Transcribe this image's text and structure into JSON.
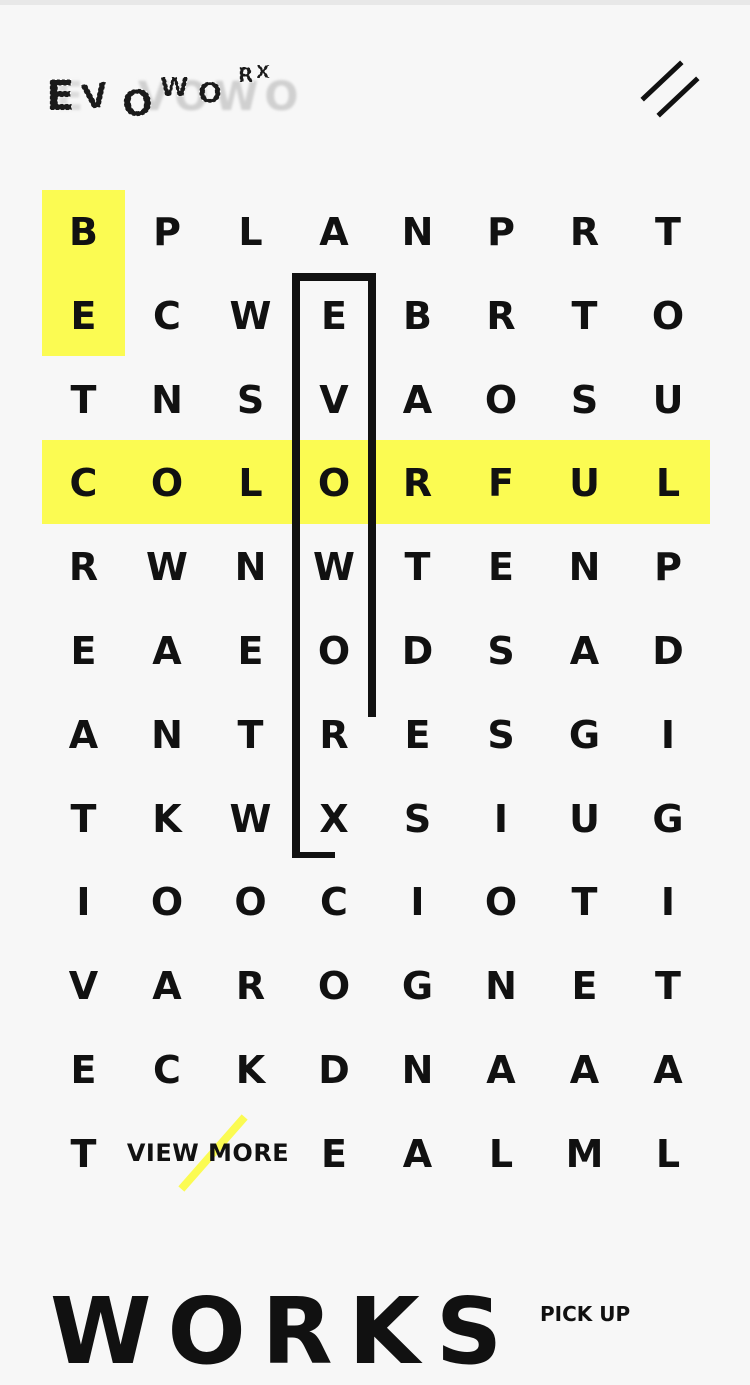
{
  "header": {
    "logo_text": "EVOWORX",
    "menu_icon": "double-slash-menu-icon"
  },
  "colors": {
    "background": "#f7f7f7",
    "highlight": "#fbfb52",
    "text": "#111111"
  },
  "puzzle": {
    "rows": [
      [
        "B",
        "P",
        "L",
        "A",
        "N",
        "P",
        "R",
        "T"
      ],
      [
        "E",
        "C",
        "W",
        "E",
        "B",
        "R",
        "T",
        "O"
      ],
      [
        "T",
        "N",
        "S",
        "V",
        "A",
        "O",
        "S",
        "U"
      ],
      [
        "C",
        "O",
        "L",
        "O",
        "R",
        "F",
        "U",
        "L"
      ],
      [
        "R",
        "W",
        "N",
        "W",
        "T",
        "E",
        "N",
        "P"
      ],
      [
        "E",
        "A",
        "E",
        "O",
        "D",
        "S",
        "A",
        "D"
      ],
      [
        "A",
        "N",
        "T",
        "R",
        "E",
        "S",
        "G",
        "I"
      ],
      [
        "T",
        "K",
        "W",
        "X",
        "S",
        "I",
        "U",
        "G"
      ],
      [
        "I",
        "O",
        "O",
        "C",
        "I",
        "O",
        "T",
        "I"
      ],
      [
        "V",
        "A",
        "R",
        "O",
        "G",
        "N",
        "E",
        "T"
      ],
      [
        "E",
        "C",
        "K",
        "D",
        "N",
        "A",
        "A",
        "A"
      ],
      [
        "T",
        "",
        "",
        "E",
        "A",
        "L",
        "M",
        "L"
      ]
    ],
    "highlighted_words": [
      "BE",
      "COLORFUL"
    ],
    "bracketed_word": "EVOWORX",
    "view_more_label": "VIEW MORE"
  },
  "works": {
    "title": "WORKS",
    "pickup_label": "PICK UP"
  }
}
